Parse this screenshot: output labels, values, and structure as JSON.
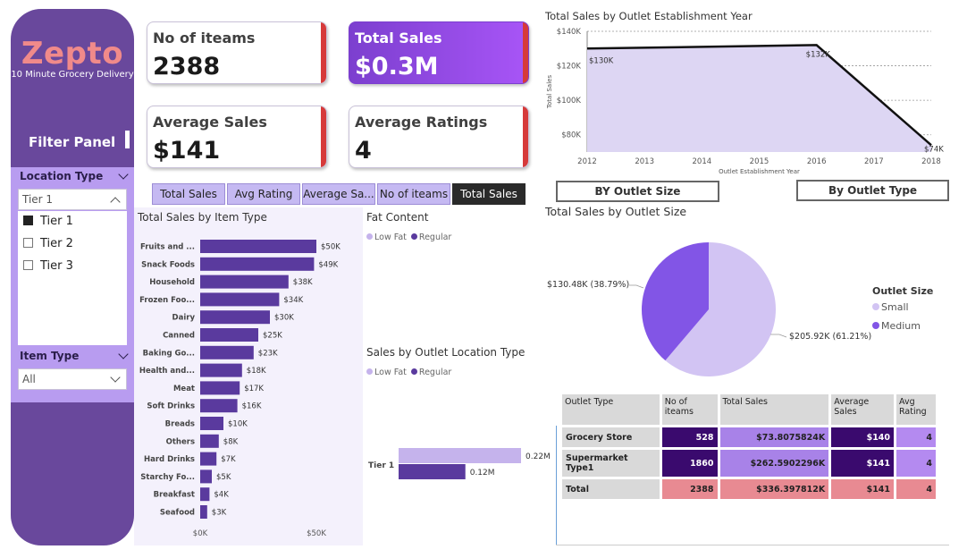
{
  "sidebar": {
    "brand": "Zepto",
    "tagline": "10 Minute Grocery Delivery",
    "filter_title": "Filter Panel",
    "location_slicer": {
      "title": "Location Type",
      "selected": "Tier 1",
      "options": [
        {
          "label": "Tier 1",
          "checked": true
        },
        {
          "label": "Tier 2",
          "checked": false
        },
        {
          "label": "Tier 3",
          "checked": false
        }
      ]
    },
    "item_slicer": {
      "title": "Item Type",
      "selected": "All"
    }
  },
  "kpis": [
    {
      "label": "No of iteams",
      "value": "2388"
    },
    {
      "label": "Total Sales",
      "value": "$0.3M"
    },
    {
      "label": "Average Sales",
      "value": "$141"
    },
    {
      "label": "Average Ratings",
      "value": "4"
    }
  ],
  "tabs": [
    "Total Sales",
    "Avg Rating",
    "Average Sa...",
    "No of iteams",
    "Total Sales"
  ],
  "active_tab": 4,
  "colors": {
    "sidebar": "#69489c",
    "slicer": "#b89cf0",
    "bar": "#5a3a9e",
    "lowfat": "#c5b3ec",
    "regular": "#5a3a9e",
    "area_fill": "#ddd6f3",
    "pie_small": "#d2c4f3",
    "pie_medium": "#8255e6",
    "accent_red": "#d63a3a"
  },
  "fat_content": {
    "title": "Fat Content",
    "legend": [
      "Low Fat",
      "Regular"
    ]
  },
  "location_chart": {
    "title": "Sales by Outlet Location Type",
    "legend": [
      "Low Fat",
      "Regular"
    ]
  },
  "outlet_buttons": {
    "size": "BY Outlet Size",
    "type": "By Outlet Type"
  },
  "table": {
    "headers": [
      "Outlet Type",
      "No of iteams",
      "Total Sales",
      "Average Sales",
      "Avg Rating"
    ],
    "rows": [
      [
        "Grocery Store",
        "528",
        "$73.8075824K",
        "$140",
        "4"
      ],
      [
        "Supermarket Type1",
        "1860",
        "$262.5902296K",
        "$141",
        "4"
      ]
    ],
    "total": [
      "Total",
      "2388",
      "$336.397812K",
      "$141",
      "4"
    ]
  },
  "chart_data": [
    {
      "type": "bar",
      "title": "Total Sales by Item Type",
      "orientation": "horizontal",
      "categories": [
        "Fruits and ...",
        "Snack Foods",
        "Household",
        "Frozen Foo...",
        "Dairy",
        "Canned",
        "Baking Go...",
        "Health and...",
        "Meat",
        "Soft Drinks",
        "Breads",
        "Others",
        "Hard Drinks",
        "Starchy Fo...",
        "Breakfast",
        "Seafood"
      ],
      "values": [
        50,
        49,
        38,
        34,
        30,
        25,
        23,
        18,
        17,
        16,
        10,
        8,
        7,
        5,
        4,
        3
      ],
      "data_labels": [
        "$50K",
        "$49K",
        "$38K",
        "$34K",
        "$30K",
        "$25K",
        "$23K",
        "$18K",
        "$17K",
        "$16K",
        "$10K",
        "$8K",
        "$7K",
        "$5K",
        "$4K",
        "$3K"
      ],
      "x_ticks": [
        "$0K",
        "$50K"
      ],
      "xlim": [
        0,
        50
      ]
    },
    {
      "type": "area",
      "title": "Total Sales by Outlet Establishment Year",
      "xlabel": "Outlet Establishment Year",
      "ylabel": "Total Sales",
      "x": [
        2012,
        2016,
        2018
      ],
      "values": [
        130,
        132,
        74
      ],
      "point_labels": [
        "$130K",
        "$132K",
        "$74K"
      ],
      "x_ticks": [
        "2012",
        "2013",
        "2014",
        "2015",
        "2016",
        "2017",
        "2018"
      ],
      "y_ticks": [
        "$80K",
        "$100K",
        "$120K",
        "$140K"
      ],
      "ylim": [
        70,
        140
      ],
      "grid": true
    },
    {
      "type": "pie",
      "title": "Total Sales by Outlet Size",
      "legend_title": "Outlet Size",
      "categories": [
        "Small",
        "Medium"
      ],
      "values": [
        205.92,
        130.48
      ],
      "labels": [
        "$205.92K (61.21%)",
        "$130.48K (38.79%)"
      ],
      "legend_position": "right"
    },
    {
      "type": "bar",
      "title": "Sales by Outlet Location Type",
      "orientation": "horizontal",
      "categories": [
        "Tier 1"
      ],
      "series": [
        {
          "name": "Low Fat",
          "values": [
            0.22
          ],
          "labels": [
            "0.22M"
          ]
        },
        {
          "name": "Regular",
          "values": [
            0.12
          ],
          "labels": [
            "0.12M"
          ]
        }
      ]
    }
  ]
}
